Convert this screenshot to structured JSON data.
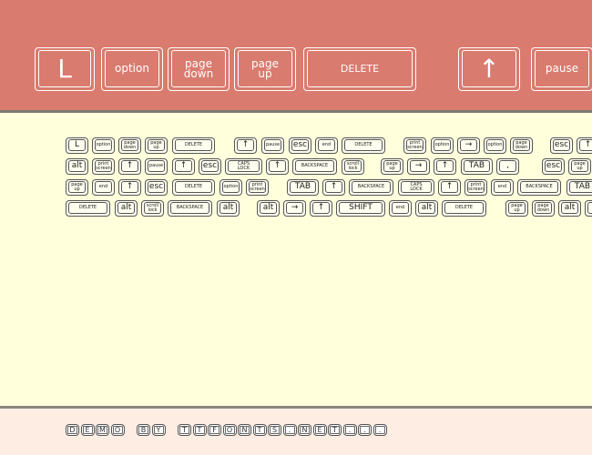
{
  "header_keys": [
    "L",
    "option",
    "page\ndown",
    "page\nup",
    "DELETE",
    "↑",
    "pause"
  ],
  "rows": [
    [
      "L",
      "option",
      "page\ndown",
      "page\nup",
      "DELETE",
      "↑",
      "pause",
      "esc",
      "end",
      "DELETE",
      "print\nscreen",
      "option",
      "→",
      "option",
      "page\ndown",
      "esc",
      "↑"
    ],
    [
      "alt",
      "print\nscreen",
      "↑",
      "pause",
      "↑",
      "esc",
      "CAPS\nLOCK",
      "↑",
      "BACKSPACE",
      "scroll\nlock",
      "page\nup",
      "→",
      "↑",
      "TAB",
      ",",
      "esc",
      "page\nup"
    ],
    [
      "page\nup",
      "end",
      "↑",
      "esc",
      "DELETE",
      "option",
      "print\nscreen",
      "TAB",
      "↑",
      "BACKSPACE",
      "CAPS\nLOCK",
      "↑",
      "print\nscreen",
      "end",
      "BACKSPACE",
      "TAB"
    ],
    [
      "DELETE",
      "alt",
      "scroll\nlock",
      "BACKSPACE",
      "alt",
      "alt",
      "→",
      "↑",
      "SHIFT",
      "end",
      "alt",
      "DELETE",
      "page\nup",
      "page\ndown",
      "alt",
      ""
    ]
  ],
  "footer_text": [
    "D",
    "E",
    "M",
    "O",
    " ",
    "B",
    "Y",
    " ",
    "T",
    "T",
    "F",
    "O",
    "N",
    "T",
    "S",
    ".",
    "N",
    "E",
    "T",
    ".",
    ".",
    "."
  ],
  "colors": {
    "header": "#d97b6e",
    "main": "#ffffdc",
    "footer": "#fdede2",
    "divider": "#7a7a70"
  }
}
